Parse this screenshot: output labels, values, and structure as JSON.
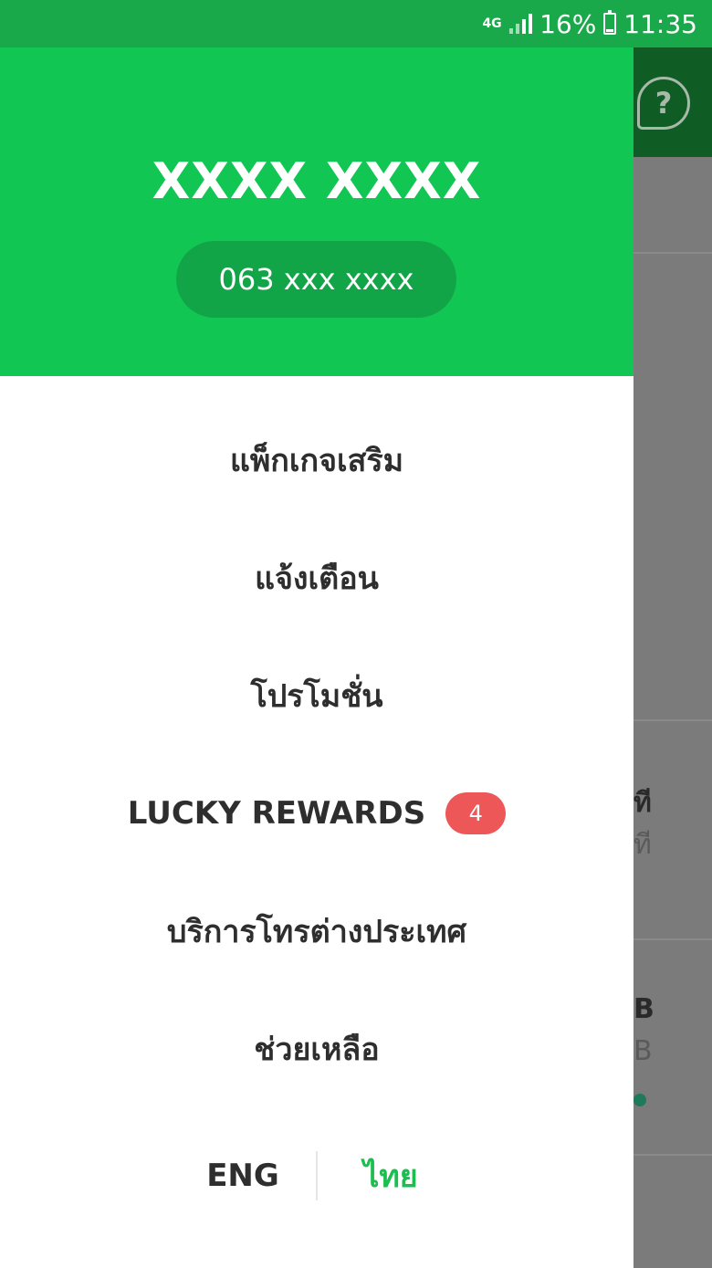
{
  "status_bar": {
    "network": "4G",
    "battery_percent": "16%",
    "battery_level": 0.16,
    "time": "11:35"
  },
  "drawer": {
    "user_name": "XXXX XXXX",
    "phone_number": "063 xxx xxxx",
    "menu_items": [
      {
        "label": "แพ็กเกจเสริม"
      },
      {
        "label": "แจ้งเตือน"
      },
      {
        "label": "โปรโมชั่น"
      },
      {
        "label": "LUCKY REWARDS",
        "badge": "4"
      },
      {
        "label": "บริการโทรต่างประเทศ"
      },
      {
        "label": "ช่วยเหลือ"
      }
    ],
    "language": {
      "options": [
        "ENG",
        "ไทย"
      ],
      "selected": "ไทย"
    }
  },
  "background_app": {
    "help_icon": "question-bubble-icon",
    "fragments": [
      "ที",
      "ที",
      "B",
      "B"
    ]
  },
  "colors": {
    "status_bar": "#19a84a",
    "drawer_header": "#12c653",
    "phone_pill": "#12a548",
    "badge": "#ee5757",
    "selected_language": "#1bbf4f"
  }
}
